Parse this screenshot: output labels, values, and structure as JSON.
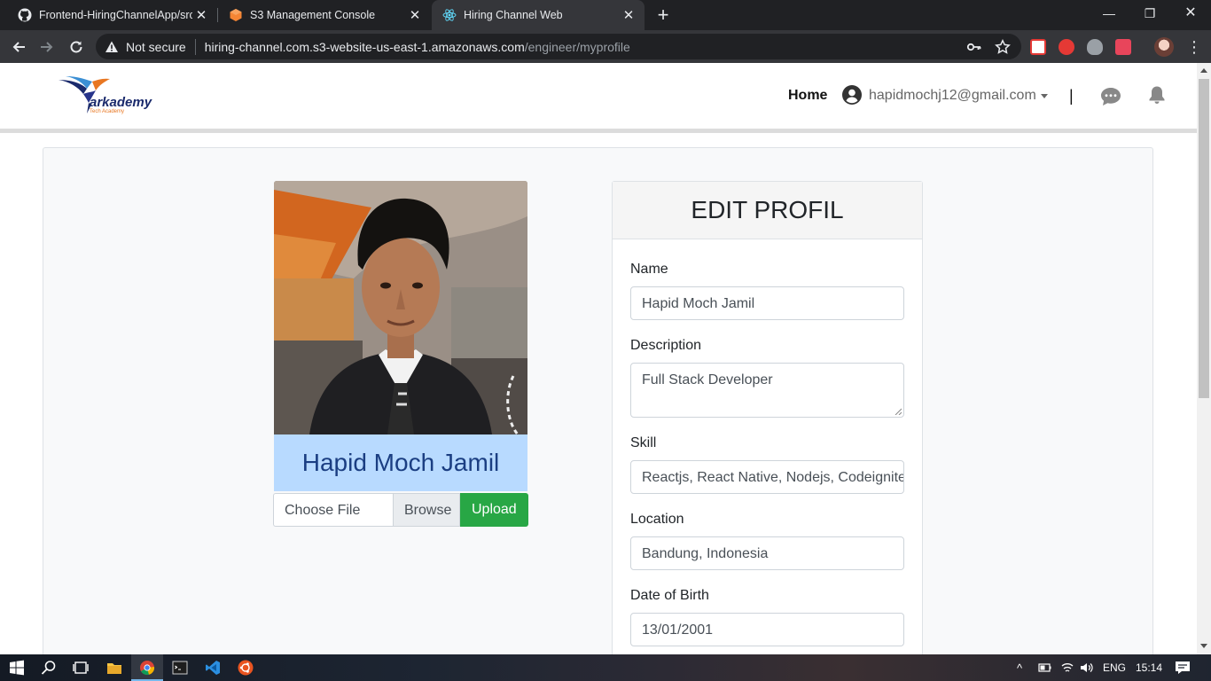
{
  "browser": {
    "tabs": [
      {
        "title": "Frontend-HiringChannelApp/src/",
        "icon": "github-icon",
        "active": false
      },
      {
        "title": "S3 Management Console",
        "icon": "aws-icon",
        "active": false
      },
      {
        "title": "Hiring Channel Web",
        "icon": "react-icon",
        "active": true
      }
    ],
    "security_label": "Not secure",
    "url_host": "hiring-channel.com.s3-website-us-east-1.amazonaws.com",
    "url_path": "/engineer/myprofile"
  },
  "navbar": {
    "brand": "arkademy",
    "brand_tagline": "Tech Academy",
    "home_label": "Home",
    "user_email": "hapidmochj12@gmail.com",
    "separator": "|"
  },
  "profile": {
    "name": "Hapid Moch Jamil",
    "file_placeholder": "Choose File",
    "browse_label": "Browse",
    "upload_label": "Upload"
  },
  "form": {
    "title": "EDIT PROFIL",
    "fields": [
      {
        "label": "Name",
        "value": "Hapid Moch Jamil"
      },
      {
        "label": "Description",
        "value": "Full Stack Developer"
      },
      {
        "label": "Skill",
        "value": "Reactjs, React Native, Nodejs, Codeigniter"
      },
      {
        "label": "Location",
        "value": "Bandung, Indonesia"
      },
      {
        "label": "Date of Birth",
        "value": "13/01/2001"
      }
    ]
  },
  "taskbar": {
    "language": "ENG",
    "time": "15:14"
  },
  "colors": {
    "upload_green": "#28a745",
    "name_banner": "#b8daff",
    "name_text": "#1b3e82"
  }
}
